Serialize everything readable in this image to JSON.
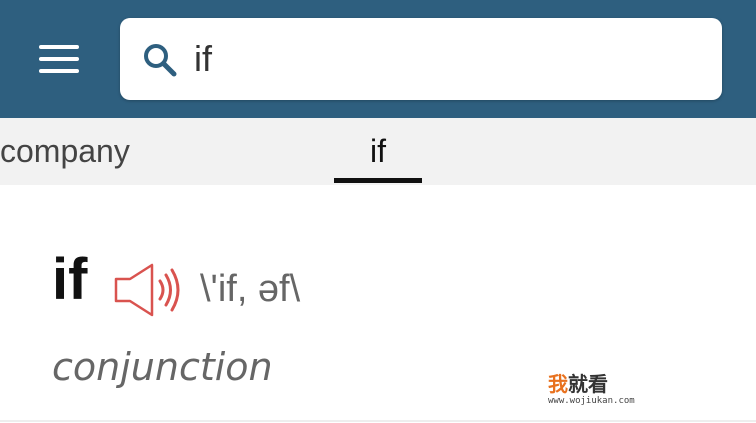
{
  "header": {
    "bg_color": "#2e5f7f",
    "menu_icon": "hamburger-menu-icon",
    "search": {
      "icon": "search-icon",
      "icon_color": "#2e5f7f",
      "value": "if"
    }
  },
  "tabs": [
    {
      "label": "company",
      "selected": false
    },
    {
      "label": "if",
      "selected": true
    }
  ],
  "entry": {
    "headword": "if",
    "audio_icon": "speaker-icon",
    "audio_icon_color": "#d9534f",
    "pronunciation": "\\'if, əf\\",
    "part_of_speech": "conjunction"
  },
  "watermark": {
    "cn_first": "我",
    "cn_rest": "就看",
    "url": "www.wojiukan.com"
  }
}
